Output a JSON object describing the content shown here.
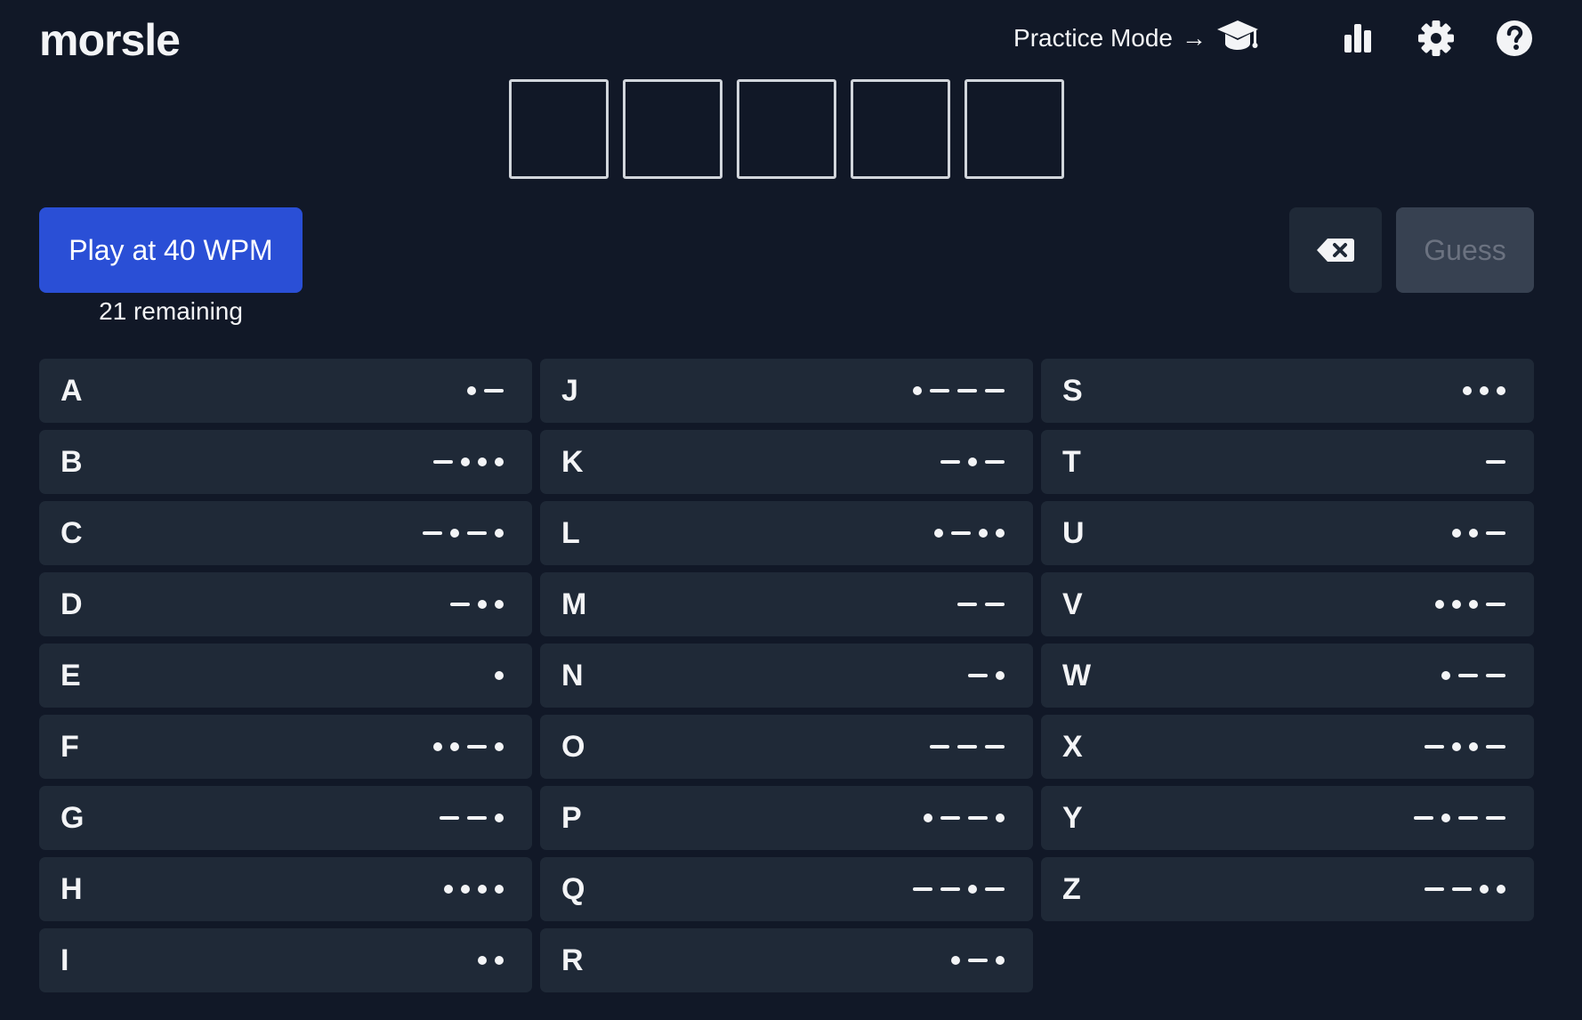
{
  "header": {
    "logo": "morsle",
    "practice_label": "Practice Mode",
    "practice_arrow": "→",
    "icons": [
      "graduation-cap-icon",
      "stats-icon",
      "gear-icon",
      "help-icon"
    ]
  },
  "board": {
    "tiles": [
      "",
      "",
      "",
      "",
      ""
    ],
    "active_tile": 0
  },
  "controls": {
    "play_label": "Play at 40 WPM",
    "remaining": "21 remaining",
    "guess_label": "Guess",
    "guess_enabled": false
  },
  "colors": {
    "background": "#111827",
    "key": "#1f2937",
    "play": "#2a4fd6",
    "guess_disabled": "#374151"
  },
  "keys": [
    [
      {
        "letter": "A",
        "code": ".-"
      },
      {
        "letter": "B",
        "code": "-..."
      },
      {
        "letter": "C",
        "code": "-.-."
      },
      {
        "letter": "D",
        "code": "-.."
      },
      {
        "letter": "E",
        "code": "."
      },
      {
        "letter": "F",
        "code": "..-."
      },
      {
        "letter": "G",
        "code": "--."
      },
      {
        "letter": "H",
        "code": "...."
      },
      {
        "letter": "I",
        "code": ".."
      }
    ],
    [
      {
        "letter": "J",
        "code": ".---"
      },
      {
        "letter": "K",
        "code": "-.-"
      },
      {
        "letter": "L",
        "code": ".-.."
      },
      {
        "letter": "M",
        "code": "--"
      },
      {
        "letter": "N",
        "code": "-."
      },
      {
        "letter": "O",
        "code": "---"
      },
      {
        "letter": "P",
        "code": ".--."
      },
      {
        "letter": "Q",
        "code": "--.-"
      },
      {
        "letter": "R",
        "code": ".-."
      }
    ],
    [
      {
        "letter": "S",
        "code": "..."
      },
      {
        "letter": "T",
        "code": "-"
      },
      {
        "letter": "U",
        "code": "..-"
      },
      {
        "letter": "V",
        "code": "...-"
      },
      {
        "letter": "W",
        "code": ".--"
      },
      {
        "letter": "X",
        "code": "-..-"
      },
      {
        "letter": "Y",
        "code": "-.--"
      },
      {
        "letter": "Z",
        "code": "--.."
      }
    ]
  ]
}
